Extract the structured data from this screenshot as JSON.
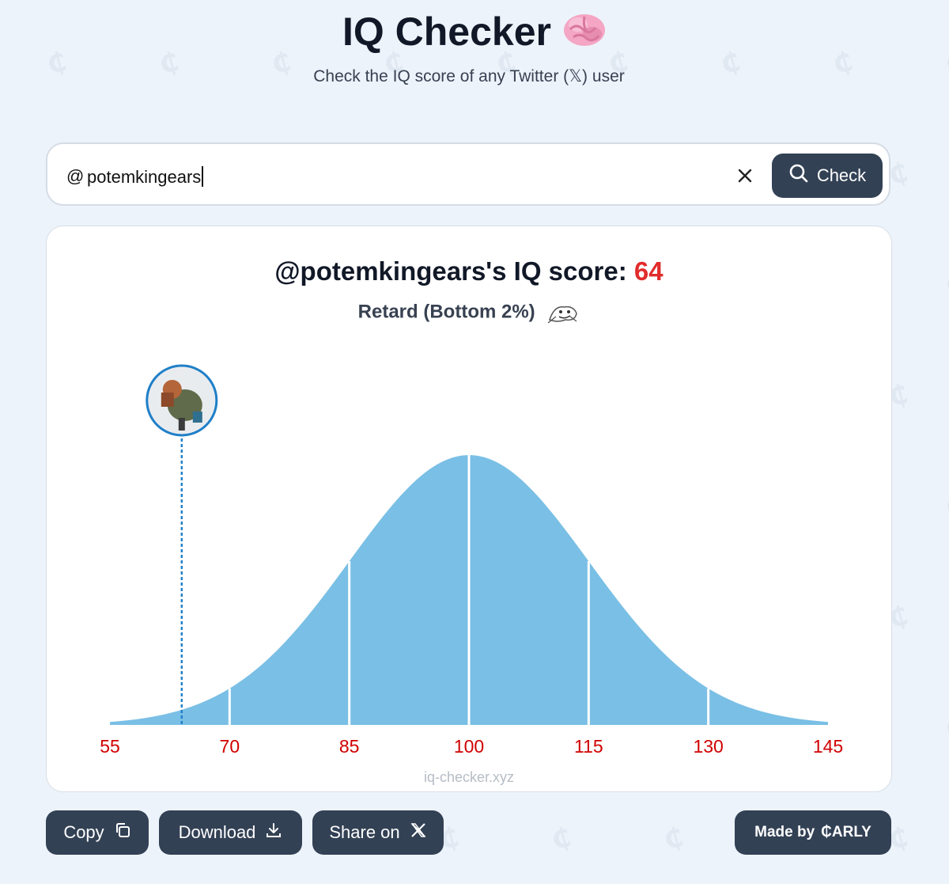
{
  "header": {
    "title": "IQ Checker",
    "subtitle": "Check the IQ score of any Twitter (𝕏) user"
  },
  "search": {
    "prefix": "@",
    "value": "potemkingears",
    "clear_icon": "close-icon",
    "button_label": "Check",
    "button_icon": "search-icon"
  },
  "result": {
    "title_prefix": "@potemkingears's IQ score: ",
    "score": "64",
    "category": "Retard (Bottom 2%)",
    "watermark": "iq-checker.xyz"
  },
  "chart_data": {
    "type": "area",
    "distribution": "normal",
    "mean": 100,
    "std": 15,
    "xlim": [
      55,
      145
    ],
    "x_ticks": [
      55,
      70,
      85,
      100,
      115,
      130,
      145
    ],
    "tick_labels": [
      "55",
      "70",
      "85",
      "100",
      "115",
      "130",
      "145"
    ],
    "divider_lines": [
      70,
      85,
      100,
      115,
      130
    ],
    "marker_value": 64,
    "fill_color": "#7abfe5",
    "tick_color": "#d00000",
    "marker_color": "#1f7fc8"
  },
  "actions": {
    "copy_label": "Copy",
    "download_label": "Download",
    "share_label": "Share on",
    "made_by_label": "Made by",
    "made_by_brand": "₵ARLY"
  },
  "colors": {
    "background": "#edf3fb",
    "button": "#334155",
    "score": "#e12c2c"
  }
}
